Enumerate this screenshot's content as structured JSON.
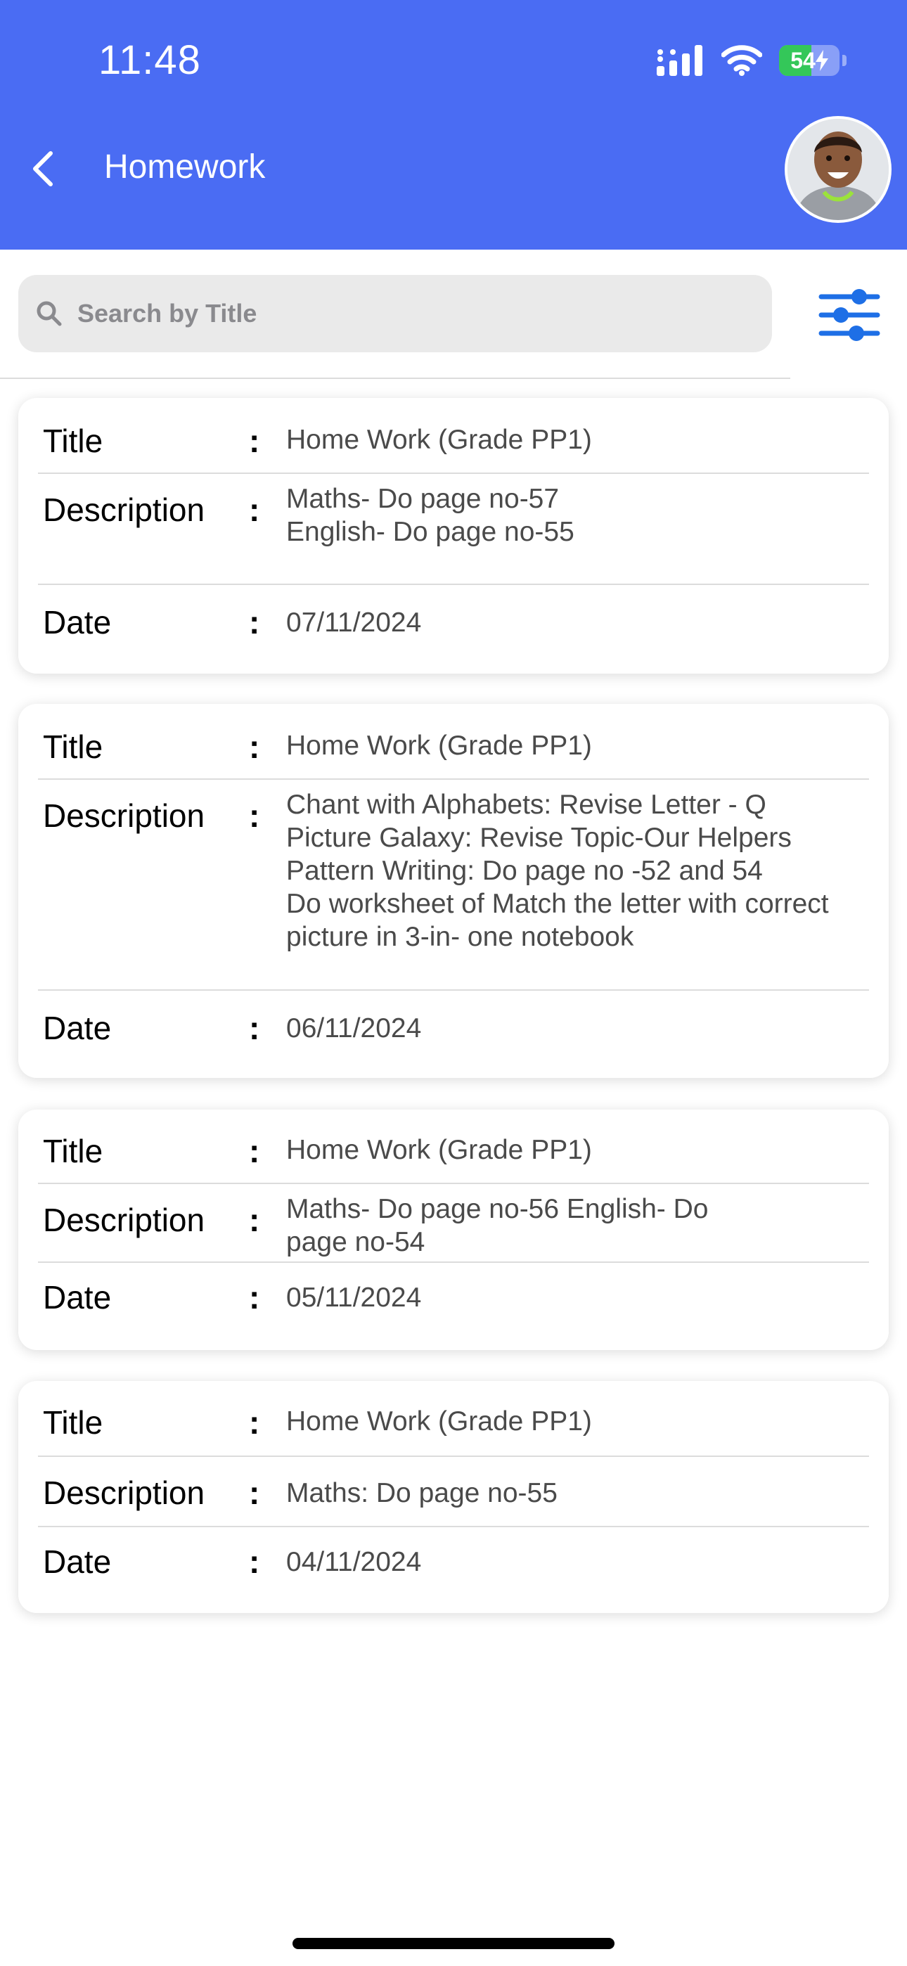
{
  "status_bar": {
    "time": "11:48",
    "battery_level": "54"
  },
  "header": {
    "title": "Homework"
  },
  "search": {
    "placeholder": "Search by Title"
  },
  "records": [
    {
      "title_label": "Title",
      "title": "Home Work (Grade PP1)",
      "description_label": "Description",
      "description": "Maths- Do page no-57\nEnglish- Do page no-55",
      "date_label": "Date",
      "date": "07/11/2024"
    },
    {
      "title_label": "Title",
      "title": "Home Work (Grade PP1)",
      "description_label": "Description",
      "description": "Chant with Alphabets: Revise Letter - Q\nPicture Galaxy: Revise Topic-Our Helpers\nPattern Writing: Do page no -52 and 54\nDo worksheet of Match the letter with correct\npicture in 3-in- one notebook",
      "date_label": "Date",
      "date": "06/11/2024"
    },
    {
      "title_label": "Title",
      "title": "Home Work (Grade PP1)",
      "description_label": "Description",
      "description": "Maths- Do page no-56 English- Do\npage no-54",
      "date_label": "Date",
      "date": "05/11/2024"
    },
    {
      "title_label": "Title",
      "title": "Home Work (Grade PP1)",
      "description_label": "Description",
      "description": "Maths: Do page no-55",
      "date_label": "Date",
      "date": "04/11/2024"
    }
  ],
  "colors": {
    "header": "#4a6cf3",
    "accent": "#1e6fe6",
    "battery_fill": "#34c759"
  },
  "icons": [
    "back-arrow-icon",
    "search-icon",
    "filter-sliders-icon",
    "cellular-signal-icon",
    "wifi-icon",
    "battery-icon",
    "charging-bolt-icon"
  ]
}
